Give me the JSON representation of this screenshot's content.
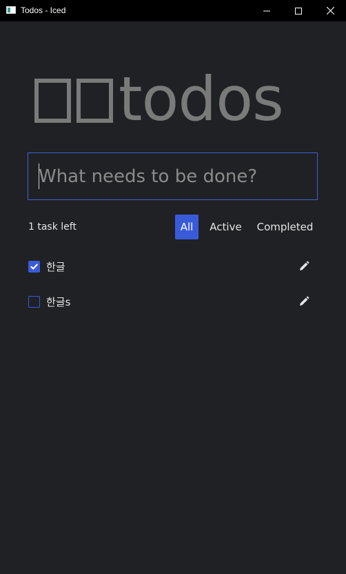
{
  "window": {
    "title": "Todos - Iced",
    "minimize_icon": "minimize-icon",
    "maximize_icon": "maximize-icon",
    "close_icon": "close-icon"
  },
  "header": {
    "title": "todos",
    "missing_glyph_count": 2
  },
  "input": {
    "placeholder": "What needs to be done?",
    "value": ""
  },
  "controls": {
    "tasks_left": "1 task left",
    "filters": [
      {
        "label": "All",
        "selected": true
      },
      {
        "label": "Active",
        "selected": false
      },
      {
        "label": "Completed",
        "selected": false
      }
    ]
  },
  "tasks": [
    {
      "label": "한글",
      "completed": true,
      "edit_icon": "pencil-icon"
    },
    {
      "label": "한글s",
      "completed": false,
      "edit_icon": "pencil-icon"
    }
  ],
  "colors": {
    "background": "#202125",
    "accent": "#3a5bd9",
    "heading": "#7a7a7a",
    "titlebar": "#000000"
  }
}
